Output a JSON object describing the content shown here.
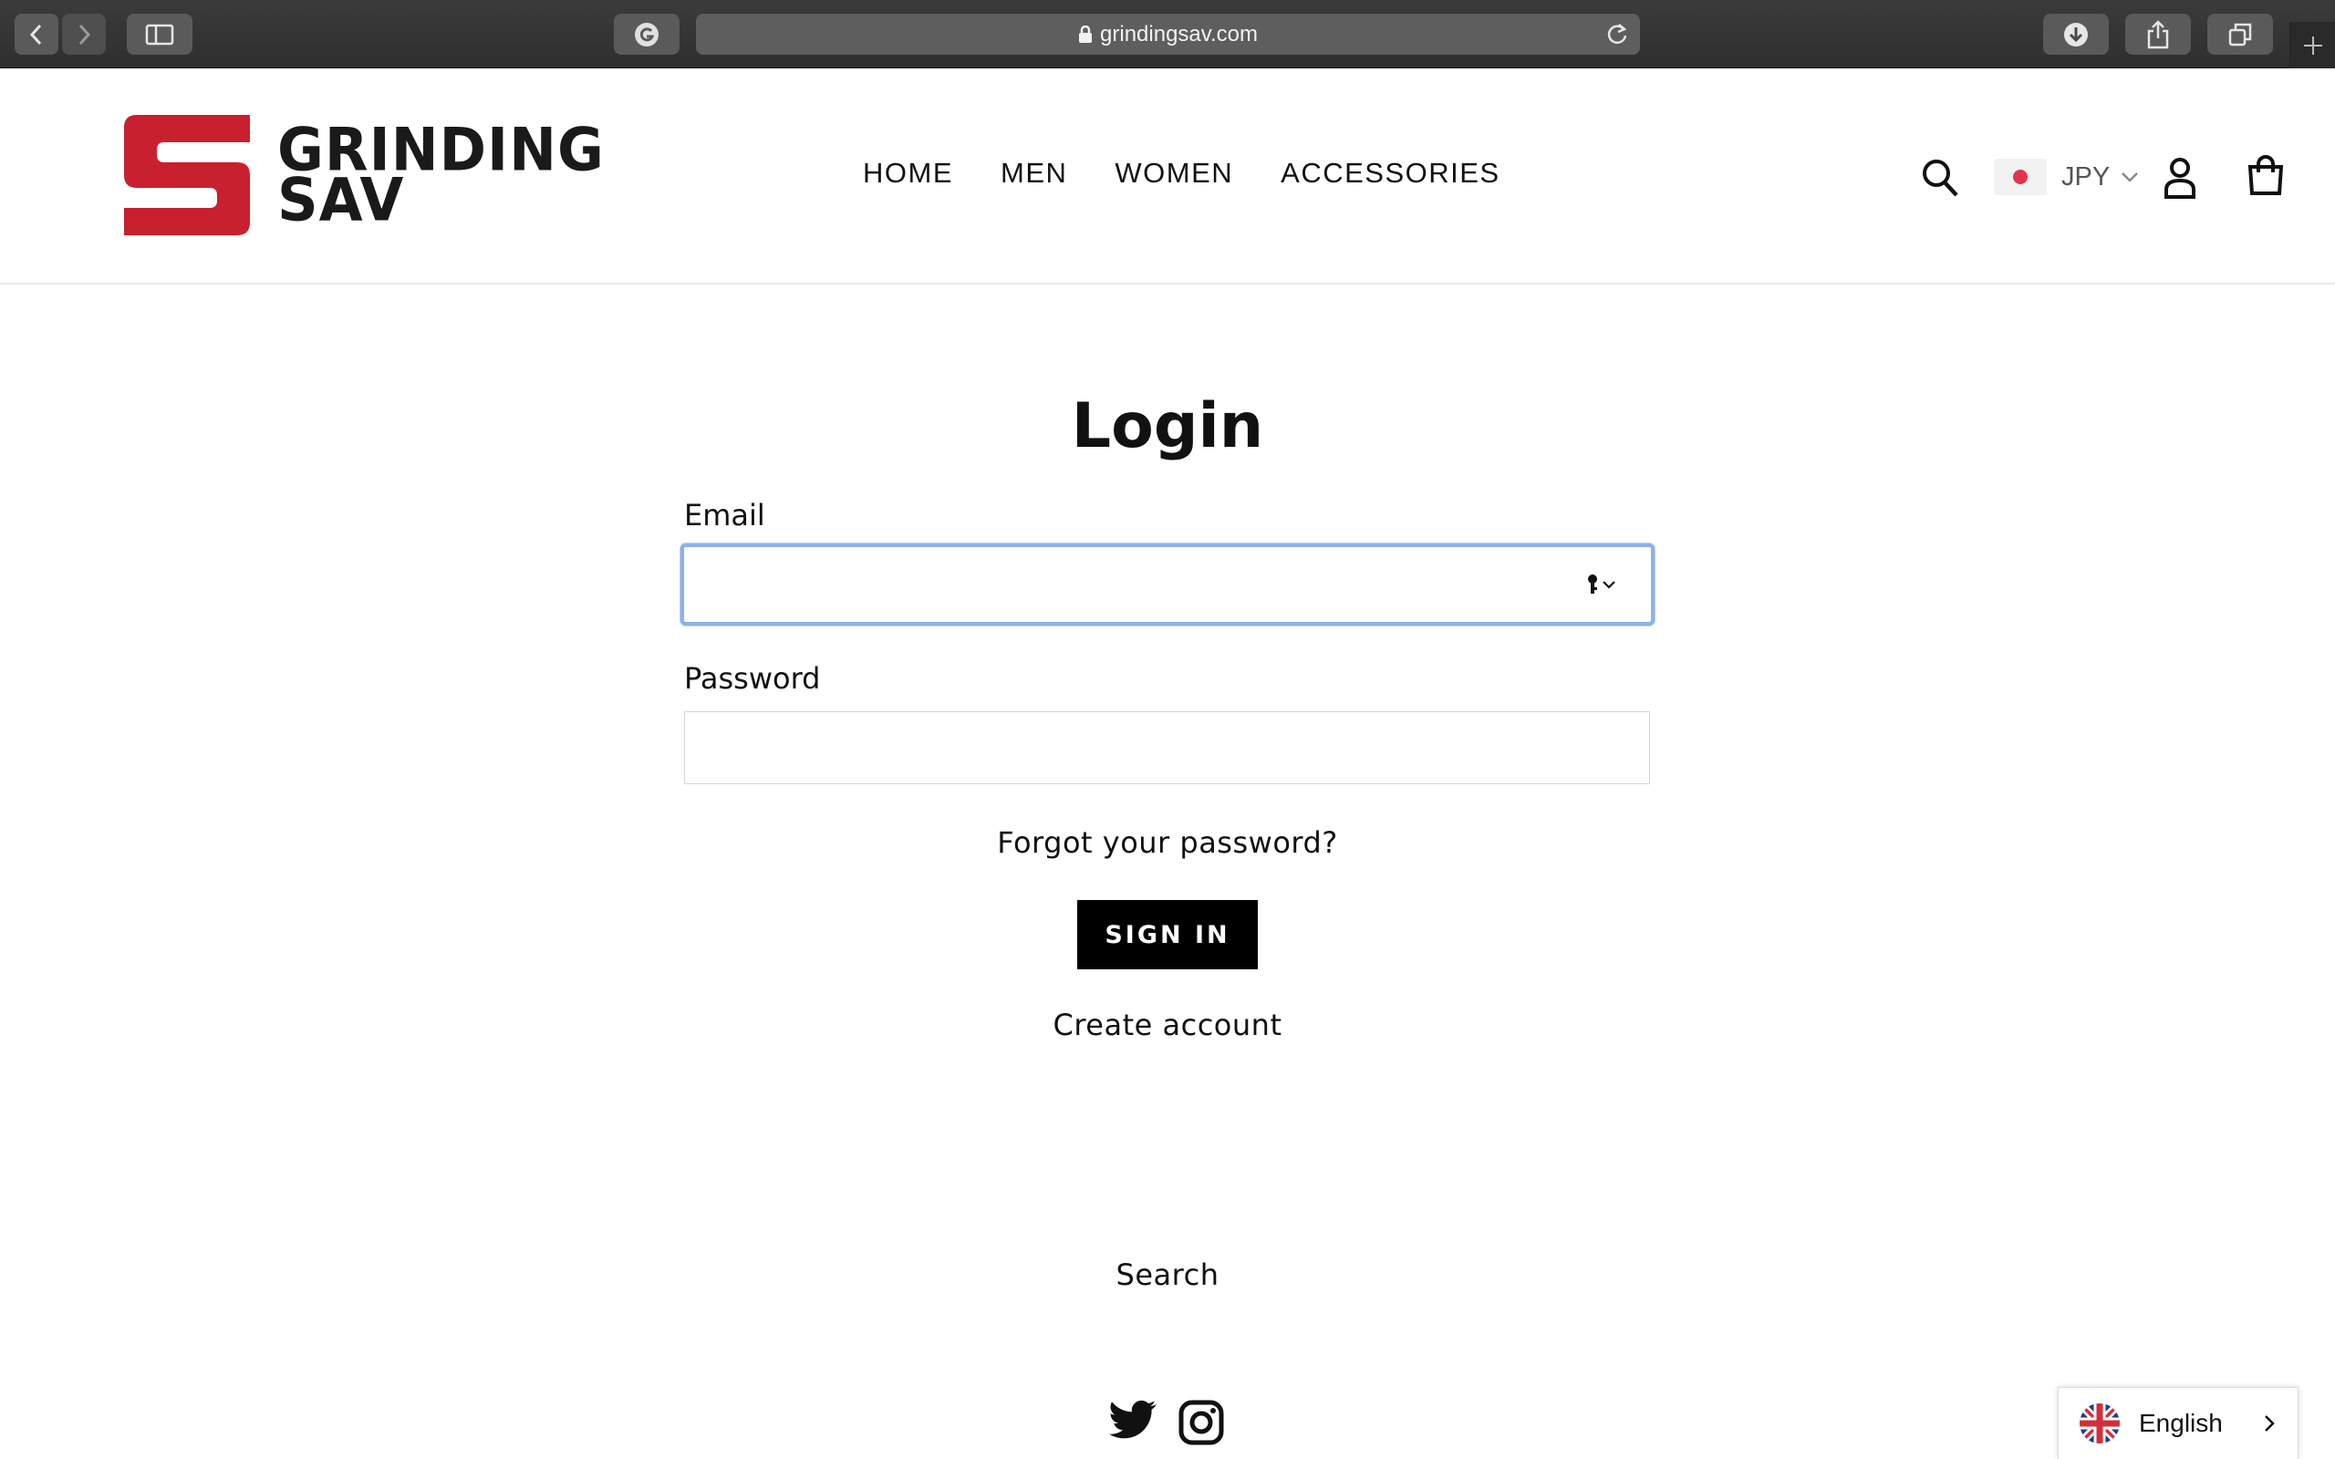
{
  "browser": {
    "url": "grindingsav.com"
  },
  "header": {
    "logo_text_line1": "GRINDING",
    "logo_text_line2": "SAV",
    "logo_color": "#c8202f",
    "nav": [
      "HOME",
      "MEN",
      "WOMEN",
      "ACCESSORIES"
    ],
    "currency": "JPY"
  },
  "login": {
    "title": "Login",
    "email_label": "Email",
    "email_value": "",
    "password_label": "Password",
    "password_value": "",
    "forgot_link": "Forgot your password?",
    "signin_button": "SIGN IN",
    "create_account_link": "Create account"
  },
  "footer": {
    "search_link": "Search",
    "social": [
      "twitter-icon",
      "instagram-icon"
    ]
  },
  "language_switcher": {
    "label": "English"
  }
}
